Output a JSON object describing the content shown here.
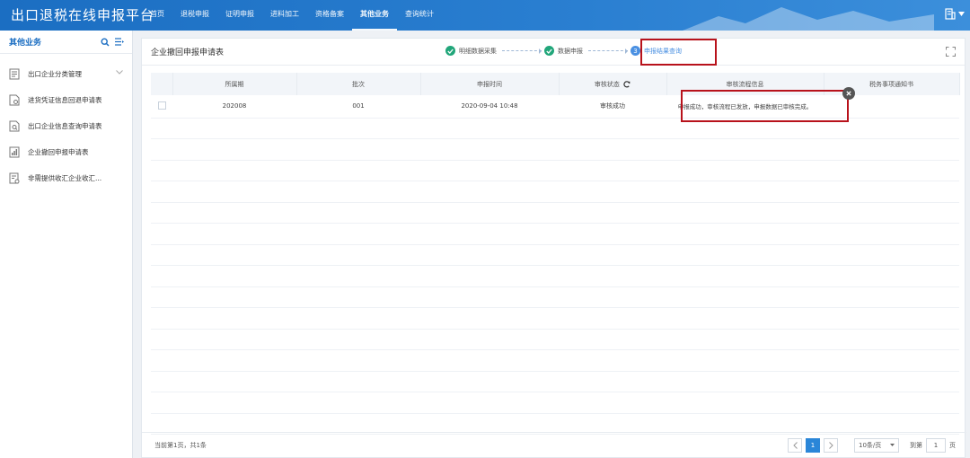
{
  "app": {
    "title": "出口退税在线申报平台"
  },
  "nav": [
    {
      "label": "首页"
    },
    {
      "label": "退税申报"
    },
    {
      "label": "证明申报"
    },
    {
      "label": "进料加工"
    },
    {
      "label": "资格备案"
    },
    {
      "label": "其他业务",
      "active": true
    },
    {
      "label": "查询统计"
    }
  ],
  "sidebar": {
    "title": "其他业务",
    "items": [
      {
        "label": "出口企业分类管理"
      },
      {
        "label": "进货凭证信息回退申请表"
      },
      {
        "label": "出口企业信息查询申请表"
      },
      {
        "label": "企业撤回申报申请表"
      },
      {
        "label": "非需提供收汇企业收汇..."
      }
    ]
  },
  "panel": {
    "title": "企业撤回申报申请表"
  },
  "steps": [
    {
      "label": "明细数据采集",
      "state": "done"
    },
    {
      "label": "数据申报",
      "state": "done"
    },
    {
      "label": "申报结果查询",
      "state": "current",
      "number": "3"
    }
  ],
  "table": {
    "headers": [
      "所属期",
      "批次",
      "申报时间",
      "审核状态",
      "审核流程信息",
      "税务事项通知书"
    ],
    "rows": [
      {
        "period": "202008",
        "batch": "001",
        "time": "2020-09-04 10:48",
        "status": "审核成功",
        "flow": "申报成功，审核流程已发放，申报数据已审核完成。",
        "notice": ""
      }
    ]
  },
  "footer": {
    "info": "当前第1页，共1条",
    "current_page": "1",
    "page_size": "10条/页",
    "goto_label": "到第",
    "goto_value": "1",
    "page_unit": "页"
  },
  "colors": {
    "header": "#1b6ec2",
    "accent": "#2a86d8",
    "success": "#21a67a",
    "highlight": "#b8121b"
  }
}
